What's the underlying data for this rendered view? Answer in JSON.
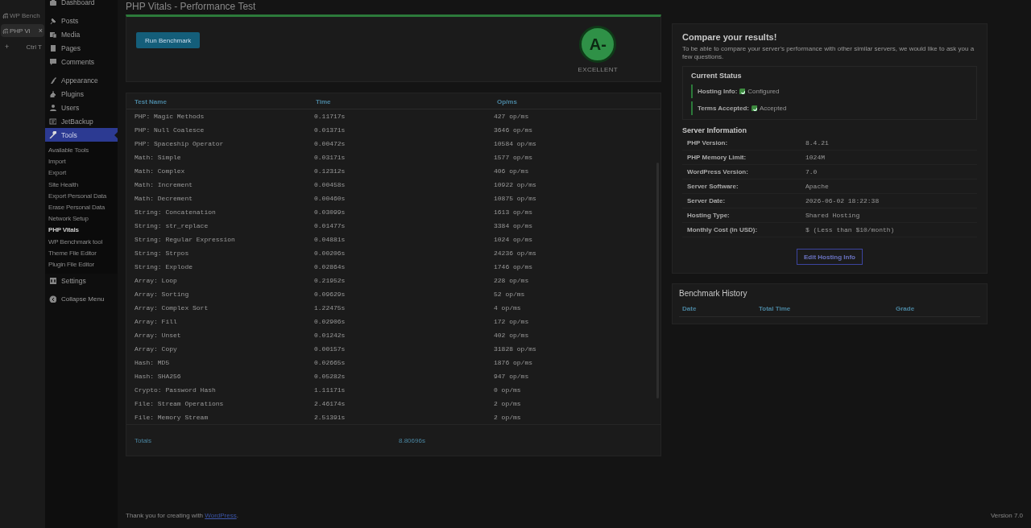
{
  "browser": {
    "tabs": [
      {
        "label": "WP Bench",
        "selected": false
      },
      {
        "label": "PHP Vi",
        "selected": true
      }
    ],
    "close_label": "×",
    "new_tab_icon": "+",
    "new_tab_shortcut": "Ctrl T"
  },
  "admin_menu": {
    "groups": [
      [
        {
          "label": "Dashboard",
          "selected": false
        }
      ],
      [
        {
          "label": "Posts",
          "selected": false
        },
        {
          "label": "Media",
          "selected": false
        },
        {
          "label": "Pages",
          "selected": false
        },
        {
          "label": "Comments",
          "selected": false
        }
      ],
      [
        {
          "label": "Appearance",
          "selected": false
        },
        {
          "label": "Plugins",
          "selected": false
        },
        {
          "label": "Users",
          "selected": false
        },
        {
          "label": "JetBackup",
          "selected": false
        },
        {
          "label": "Tools",
          "selected": true,
          "children": [
            {
              "label": "Available Tools",
              "selected": false
            },
            {
              "label": "Import",
              "selected": false
            },
            {
              "label": "Export",
              "selected": false
            },
            {
              "label": "Site Health",
              "selected": false
            },
            {
              "label": "Export Personal Data",
              "selected": false
            },
            {
              "label": "Erase Personal Data",
              "selected": false
            },
            {
              "label": "Network Setup",
              "selected": false
            },
            {
              "label": "PHP Vitals",
              "selected": true
            },
            {
              "label": "WP Benchmark tool",
              "selected": false
            },
            {
              "label": "Theme File Editor",
              "selected": false
            },
            {
              "label": "Plugin File Editor",
              "selected": false
            }
          ]
        },
        {
          "label": "Settings",
          "selected": false
        }
      ]
    ],
    "collapse_label": "Collapse Menu"
  },
  "page_title": "PHP Vitals - Performance Test",
  "benchmark": {
    "run_button": "Run Benchmark",
    "grade": "A-",
    "grade_label": "EXCELLENT",
    "table": {
      "columns": [
        "Test Name",
        "Time",
        "Op/ms"
      ],
      "rows": [
        [
          "PHP: Magic Methods",
          "0.11717s",
          "427 op/ms"
        ],
        [
          "PHP: Null Coalesce",
          "0.01371s",
          "3646 op/ms"
        ],
        [
          "PHP: Spaceship Operator",
          "0.00472s",
          "10584 op/ms"
        ],
        [
          "Math: Simple",
          "0.03171s",
          "1577 op/ms"
        ],
        [
          "Math: Complex",
          "0.12312s",
          "406 op/ms"
        ],
        [
          "Math: Increment",
          "0.00458s",
          "10922 op/ms"
        ],
        [
          "Math: Decrement",
          "0.00460s",
          "10875 op/ms"
        ],
        [
          "String: Concatenation",
          "0.03099s",
          "1613 op/ms"
        ],
        [
          "String: str_replace",
          "0.01477s",
          "3384 op/ms"
        ],
        [
          "String: Regular Expression",
          "0.04881s",
          "1024 op/ms"
        ],
        [
          "String: Strpos",
          "0.00206s",
          "24236 op/ms"
        ],
        [
          "String: Explode",
          "0.02864s",
          "1746 op/ms"
        ],
        [
          "Array: Loop",
          "0.21952s",
          "228 op/ms"
        ],
        [
          "Array: Sorting",
          "0.09629s",
          "52 op/ms"
        ],
        [
          "Array: Complex Sort",
          "1.22475s",
          "4 op/ms"
        ],
        [
          "Array: Fill",
          "0.02906s",
          "172 op/ms"
        ],
        [
          "Array: Unset",
          "0.01242s",
          "402 op/ms"
        ],
        [
          "Array: Copy",
          "0.00157s",
          "31828 op/ms"
        ],
        [
          "Hash: MD5",
          "0.02665s",
          "1876 op/ms"
        ],
        [
          "Hash: SHA256",
          "0.05282s",
          "947 op/ms"
        ],
        [
          "Crypto: Password Hash",
          "1.11171s",
          "0 op/ms"
        ],
        [
          "File: Stream Operations",
          "2.46174s",
          "2 op/ms"
        ],
        [
          "File: Memory Stream",
          "2.51391s",
          "2 op/ms"
        ]
      ],
      "totals_label": "Totals",
      "totals_time": "8.80696s"
    }
  },
  "compare": {
    "title": "Compare your results!",
    "intro": "To be able to compare your server's performance with other similar servers, we would like to ask you a few questions.",
    "status_title": "Current Status",
    "status": [
      {
        "label": "Hosting Info:",
        "value": "Configured",
        "checked": true
      },
      {
        "label": "Terms Accepted:",
        "value": "Accepted",
        "checked": true
      }
    ],
    "server_title": "Server Information",
    "server": [
      {
        "label": "PHP Version:",
        "value": "8.4.21"
      },
      {
        "label": "PHP Memory Limit:",
        "value": "1024M"
      },
      {
        "label": "WordPress Version:",
        "value": "7.0"
      },
      {
        "label": "Server Software:",
        "value": "Apache"
      },
      {
        "label": "Server Date:",
        "value": "2026-06-02 18:22:38"
      },
      {
        "label": "Hosting Type:",
        "value": "Shared Hosting"
      },
      {
        "label": "Monthly Cost (in USD):",
        "value": "$ (Less than $10/month)"
      }
    ],
    "edit_button": "Edit Hosting Info"
  },
  "history": {
    "title": "Benchmark History",
    "columns": [
      "Date",
      "Total Time",
      "Grade"
    ]
  },
  "footer": {
    "text_before": "Thank you for creating with ",
    "link": "WordPress",
    "text_after": ".",
    "version": "Version 7.0"
  }
}
